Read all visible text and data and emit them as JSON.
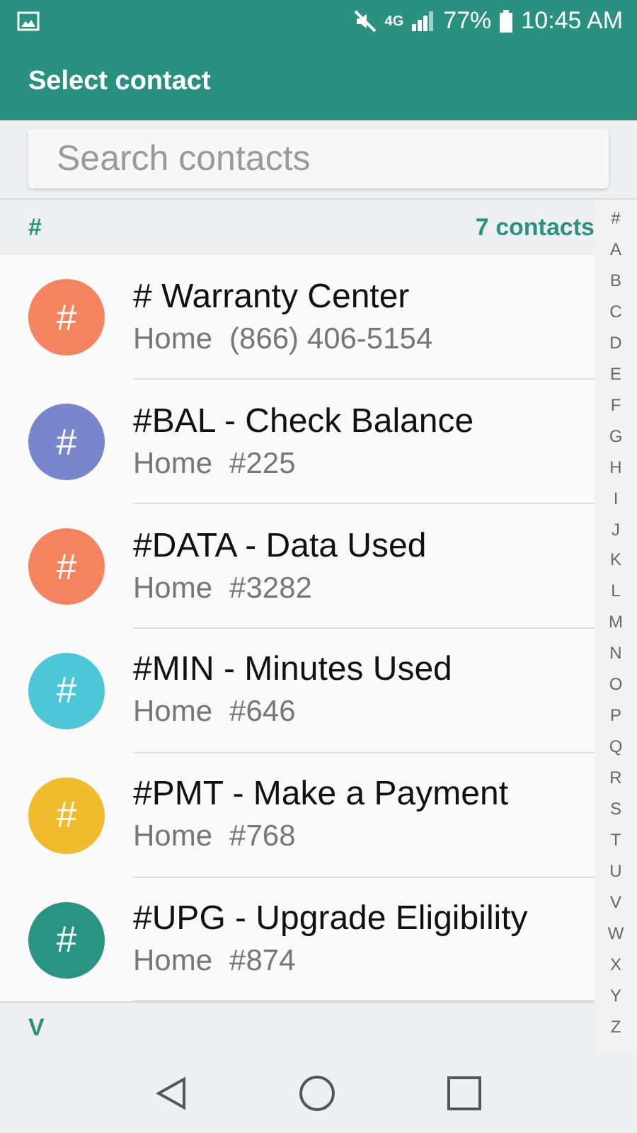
{
  "status_bar": {
    "battery": "77%",
    "time": "10:45 AM",
    "network": "4G"
  },
  "header": {
    "title": "Select contact"
  },
  "search": {
    "placeholder": "Search contacts"
  },
  "section": {
    "letter": "#",
    "count": "7 contacts"
  },
  "contacts": [
    {
      "initial": "#",
      "name": "# Warranty Center",
      "label": "Home",
      "number": "(866) 406-5154",
      "color": "#f3845f"
    },
    {
      "initial": "#",
      "name": "#BAL - Check Balance",
      "label": "Home",
      "number": "#225",
      "color": "#7986cb"
    },
    {
      "initial": "#",
      "name": "#DATA - Data Used",
      "label": "Home",
      "number": "#3282",
      "color": "#f3845f"
    },
    {
      "initial": "#",
      "name": "#MIN - Minutes Used",
      "label": "Home",
      "number": "#646",
      "color": "#4dc6d8"
    },
    {
      "initial": "#",
      "name": "#PMT - Make a Payment",
      "label": "Home",
      "number": "#768",
      "color": "#f0bb2d"
    },
    {
      "initial": "#",
      "name": "#UPG - Upgrade Eligibility",
      "label": "Home",
      "number": "#874",
      "color": "#2a9482"
    }
  ],
  "next_section": {
    "letter": "V"
  },
  "index": [
    "#",
    "A",
    "B",
    "C",
    "D",
    "E",
    "F",
    "G",
    "H",
    "I",
    "J",
    "K",
    "L",
    "M",
    "N",
    "O",
    "P",
    "Q",
    "R",
    "S",
    "T",
    "U",
    "V",
    "W",
    "X",
    "Y",
    "Z"
  ]
}
